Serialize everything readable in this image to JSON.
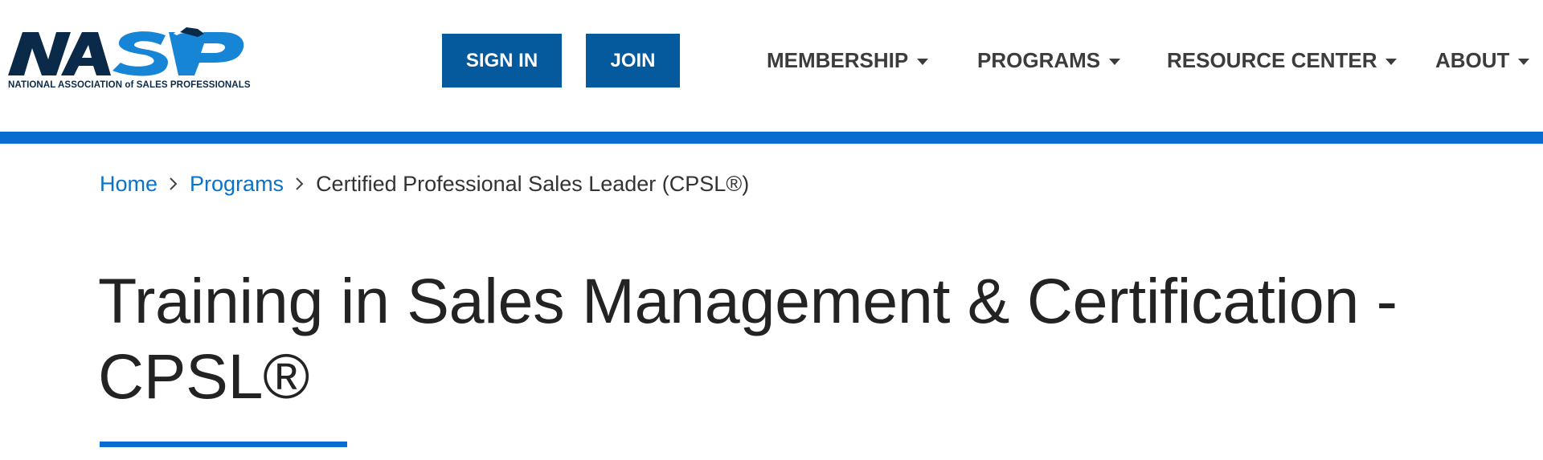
{
  "logo": {
    "mark_text": "NASP",
    "caption": "NATIONAL ASSOCIATION of SALES PROFESSIONALS",
    "colors": {
      "dark_navy": "#0b2a4a",
      "bright_blue": "#1785d6"
    }
  },
  "header": {
    "sign_in_label": "SIGN IN",
    "join_label": "JOIN",
    "button_color": "#055a9e"
  },
  "nav": {
    "items": [
      {
        "label": "MEMBERSHIP",
        "icon": "caret-down-icon"
      },
      {
        "label": "PROGRAMS",
        "icon": "caret-down-icon"
      },
      {
        "label": "RESOURCE CENTER",
        "icon": "caret-down-icon"
      },
      {
        "label": "ABOUT",
        "icon": "caret-down-icon"
      }
    ]
  },
  "accent_color": "#0a6ccf",
  "breadcrumb": {
    "items": [
      {
        "label": "Home",
        "link": true
      },
      {
        "label": "Programs",
        "link": true
      },
      {
        "label": "Certified Professional Sales Leader (CPSL®)",
        "link": false
      }
    ],
    "separator_icon": "chevron-right-icon",
    "link_color": "#0a72c8"
  },
  "page": {
    "title_line1": "Training in Sales Management & Certification -",
    "title_line2": "CPSL®"
  }
}
